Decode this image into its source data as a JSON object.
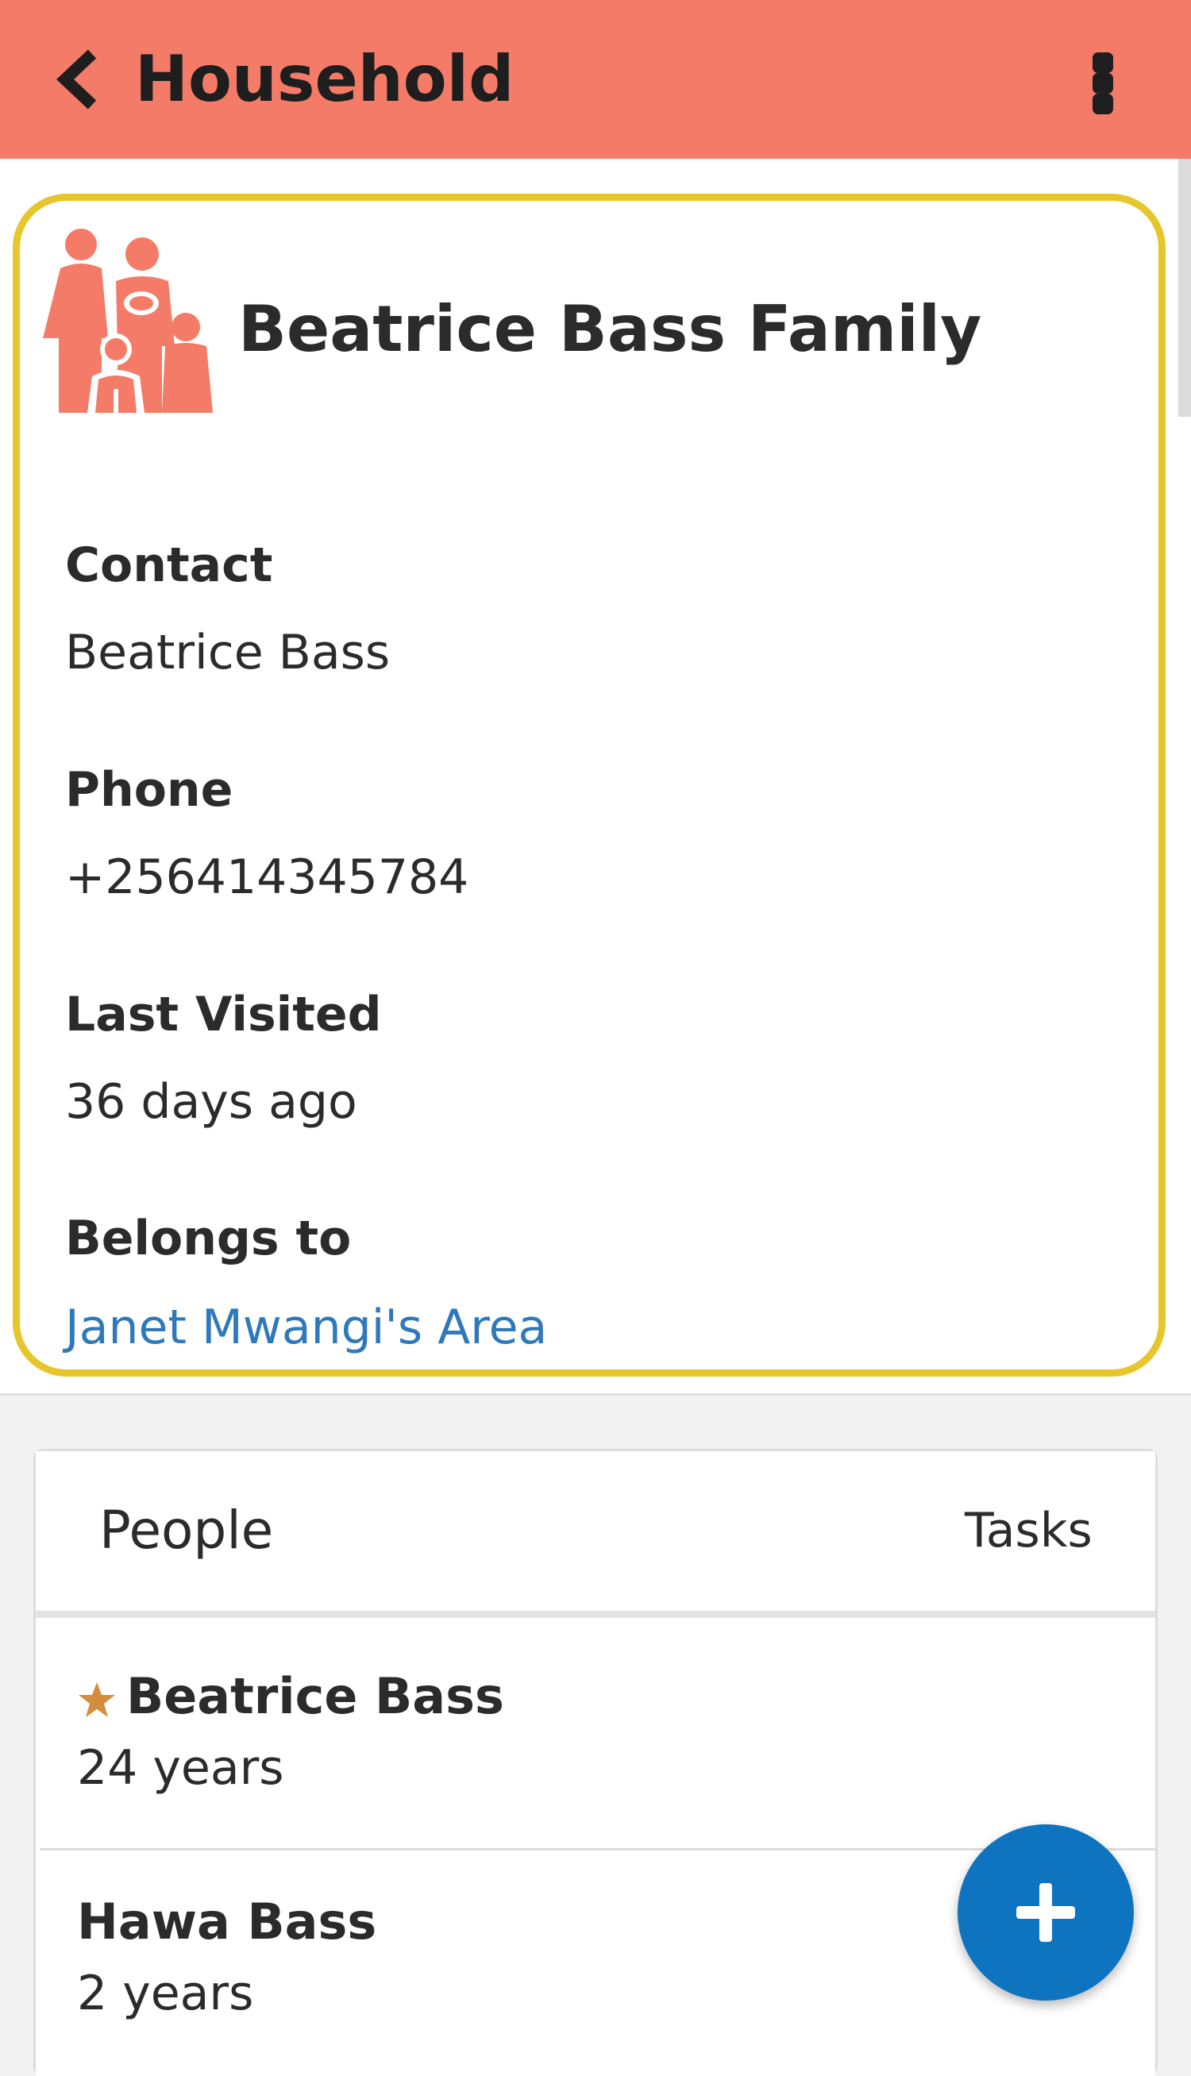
{
  "header": {
    "title": "Household",
    "background_color": "#f47b67"
  },
  "household": {
    "name": "Beatrice Bass Family",
    "icon": "family-icon",
    "icon_color": "#f47b67",
    "highlight_color": "#e6c62a",
    "fields": {
      "contact": {
        "label": "Contact",
        "value": "Beatrice Bass"
      },
      "phone": {
        "label": "Phone",
        "value": "+256414345784"
      },
      "last_visited": {
        "label": "Last Visited",
        "value": "36 days ago"
      },
      "belongs_to": {
        "label": "Belongs to",
        "value": "Janet Mwangi's Area",
        "link_color": "#2f79bb"
      }
    }
  },
  "tabs": [
    {
      "label": "People"
    },
    {
      "label": "Tasks"
    }
  ],
  "people": [
    {
      "name": "Beatrice Bass",
      "age": "24 years",
      "primary_contact": true,
      "star_color": "#d38d3c"
    },
    {
      "name": "Hawa Bass",
      "age": "2 years",
      "primary_contact": false
    }
  ],
  "fab": {
    "icon": "plus-icon",
    "color": "#0f74bf"
  }
}
